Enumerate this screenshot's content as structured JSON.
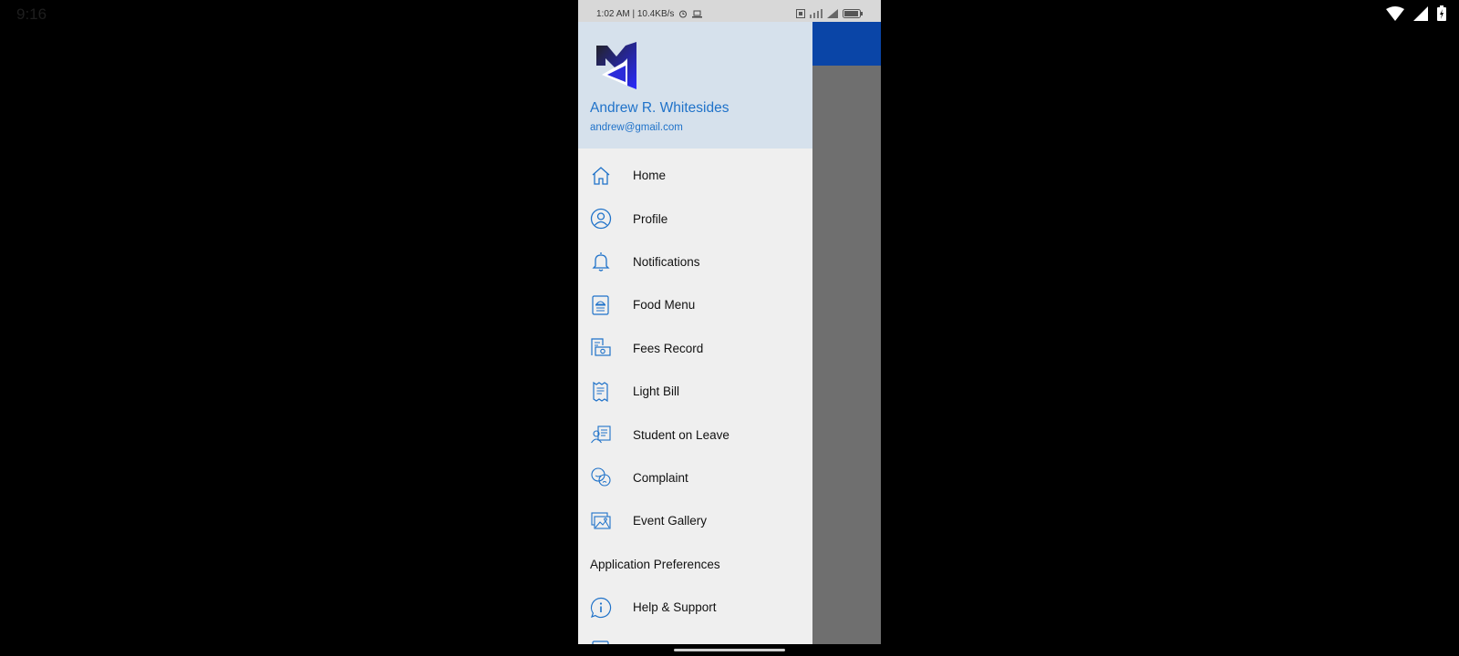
{
  "host_status": {
    "clock": "9:16"
  },
  "phone_status": {
    "time_speed": "1:02 AM | 10.4KB/s"
  },
  "drawer": {
    "user_name": "Andrew R. Whitesides",
    "user_email": "andrew@gmail.com",
    "items": [
      {
        "label": "Home",
        "icon": "home-icon"
      },
      {
        "label": "Profile",
        "icon": "profile-icon"
      },
      {
        "label": "Notifications",
        "icon": "bell-icon"
      },
      {
        "label": "Food Menu",
        "icon": "food-menu-icon"
      },
      {
        "label": "Fees Record",
        "icon": "fees-icon"
      },
      {
        "label": "Light Bill",
        "icon": "receipt-icon"
      },
      {
        "label": "Student on Leave",
        "icon": "student-leave-icon"
      },
      {
        "label": "Complaint",
        "icon": "complaint-icon"
      },
      {
        "label": "Event Gallery",
        "icon": "gallery-icon"
      }
    ],
    "section_title": "Application Preferences",
    "pref_items": [
      {
        "label": "Help & Support",
        "icon": "info-icon"
      }
    ]
  },
  "colors": {
    "accent": "#1f72c9",
    "appbar": "#0a45a7",
    "drawer_bg": "#efefef",
    "header_bg": "#d6e1ec"
  }
}
